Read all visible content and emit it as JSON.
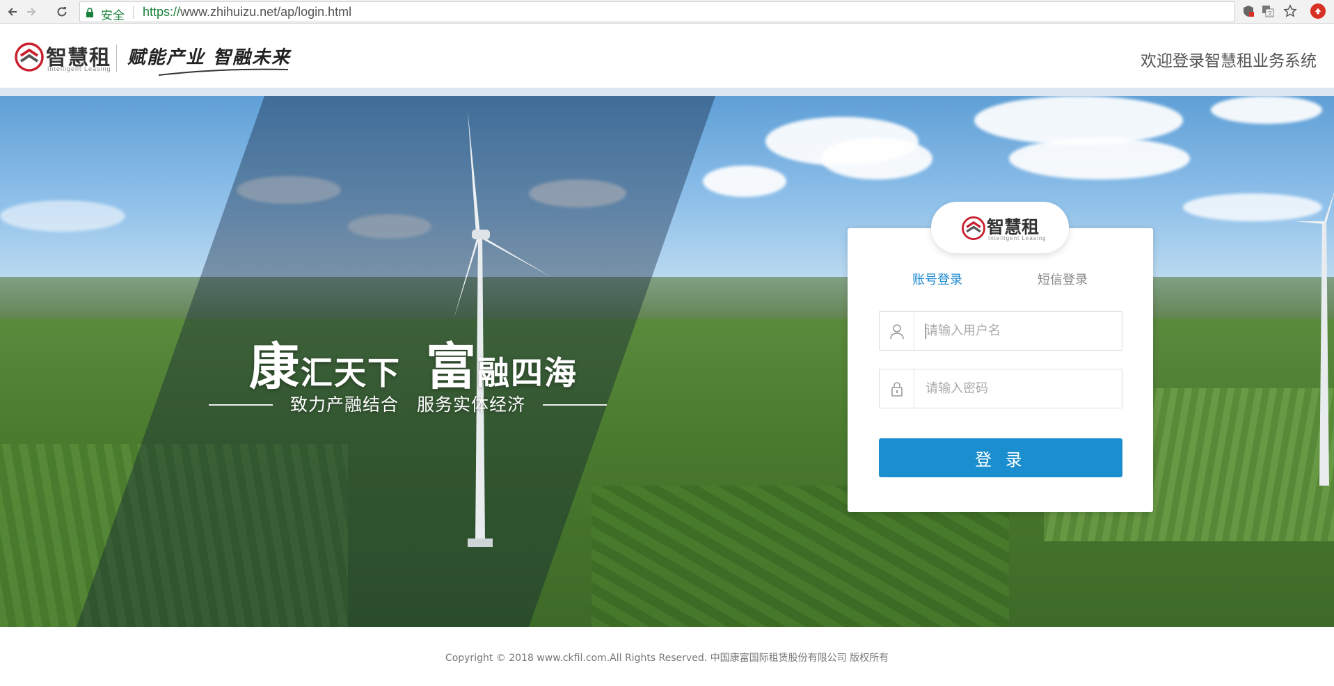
{
  "browser": {
    "secure_label": "安全",
    "url_scheme": "https://",
    "url_rest": "www.zhihuizu.net/ap/login.html"
  },
  "header": {
    "logo_cn": "智慧租",
    "logo_en": "Intelligent Leasing",
    "slogan": "赋能产业 智融未来",
    "welcome": "欢迎登录智慧租业务系统"
  },
  "hero": {
    "line1_big_a": "康",
    "line1_small_a": "汇天下",
    "line1_big_b": "富",
    "line1_small_b": "融四海",
    "line2": "致力产融结合　服务实体经济"
  },
  "login": {
    "logo_cn": "智慧租",
    "logo_en": "Intelligent Leasing",
    "tab_account": "账号登录",
    "tab_sms": "短信登录",
    "username_placeholder": "请输入用户名",
    "password_placeholder": "请输入密码",
    "submit_label": "登 录"
  },
  "footer": {
    "copyright": "Copyright © 2018 www.ckfil.com.All Rights Reserved. 中国康富国际租赁股份有限公司 版权所有"
  },
  "colors": {
    "accent": "#1a8ece",
    "tab_active": "#1d8ad0",
    "brand_red": "#c8202f"
  },
  "icons": [
    "back-icon",
    "forward-icon",
    "reload-icon",
    "lock-icon",
    "shield-icon",
    "translate-icon",
    "star-icon",
    "profile-icon",
    "user-icon",
    "padlock-icon"
  ]
}
